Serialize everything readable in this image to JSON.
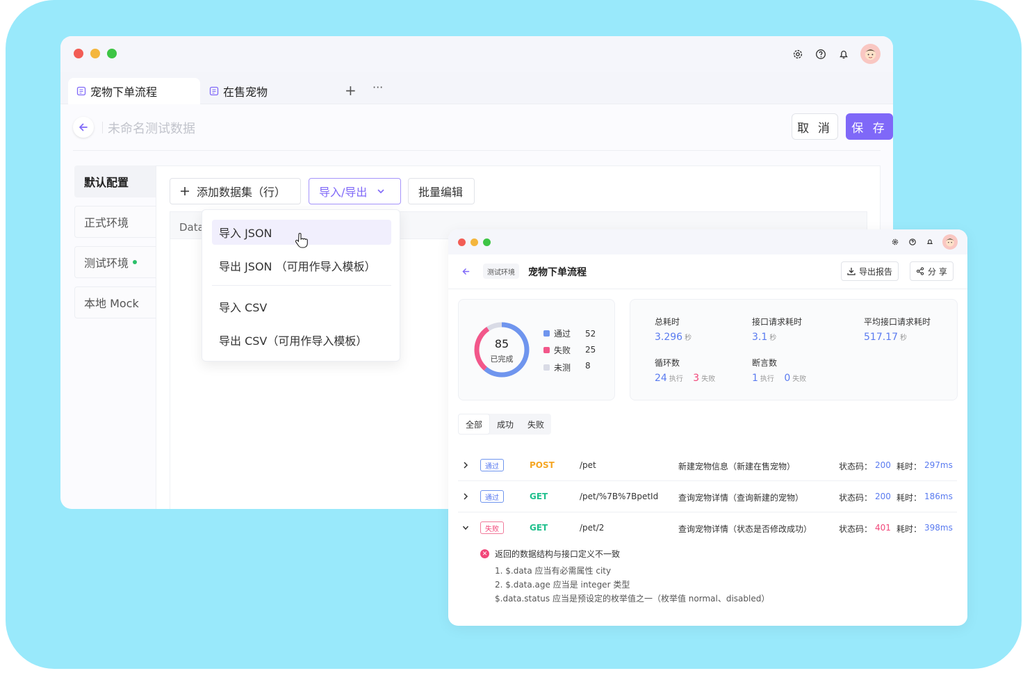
{
  "main": {
    "tabs": [
      {
        "label": "宠物下单流程",
        "active": true
      },
      {
        "label": "在售宠物",
        "active": false
      }
    ],
    "add_tab": "+",
    "more_tabs": "···",
    "title_placeholder": "未命名测试数据",
    "cancel_label": "取 消",
    "save_label": "保 存",
    "env_items": [
      {
        "label": "默认配置",
        "active": true
      },
      {
        "label": "正式环境"
      },
      {
        "label": "测试环境",
        "status": "online"
      },
      {
        "label": "本地 Mock"
      }
    ],
    "toolbar": {
      "add_dataset": "添加数据集（行）",
      "import_export": "导入/导出",
      "batch_edit": "批量编辑"
    },
    "grid_header": "Data",
    "dropdown": [
      {
        "label": "导入 JSON",
        "hover": true
      },
      {
        "label": "导出 JSON （可用作导入模板）"
      },
      {
        "label": "导入 CSV"
      },
      {
        "label": "导出 CSV（可用作导入模板）"
      }
    ]
  },
  "report": {
    "env_tag": "测试环境",
    "title": "宠物下单流程",
    "export_label": "导出报告",
    "share_label": "分 享",
    "summary": {
      "completed": "85",
      "completed_label": "已完成",
      "legend": [
        {
          "label": "通过",
          "value": "52",
          "color": "#6f95ee"
        },
        {
          "label": "失败",
          "value": "25",
          "color": "#f2578a"
        },
        {
          "label": "未测",
          "value": "8",
          "color": "#d9dbe6"
        }
      ]
    },
    "stats": {
      "total_time_label": "总耗时",
      "total_time": "3.296",
      "total_time_unit": "秒",
      "api_time_label": "接口请求耗时",
      "api_time": "3.1",
      "api_time_unit": "秒",
      "avg_time_label": "平均接口请求耗时",
      "avg_time": "517.17",
      "avg_time_unit": "秒",
      "loops_label": "循环数",
      "loops_run": "24",
      "loops_run_unit": "执行",
      "loops_fail": "3",
      "loops_fail_unit": "失败",
      "asserts_label": "断言数",
      "asserts_run": "1",
      "asserts_run_unit": "执行",
      "asserts_fail": "0",
      "asserts_fail_unit": "失败"
    },
    "filters": [
      {
        "label": "全部",
        "active": true
      },
      {
        "label": "成功"
      },
      {
        "label": "失败"
      }
    ],
    "code_label": "状态码：",
    "time_label": "耗时：",
    "rows": [
      {
        "status": "通过",
        "method": "POST",
        "path": "/pet",
        "desc": "新建宠物信息（新建在售宠物）",
        "code": "200",
        "time": "297ms"
      },
      {
        "status": "通过",
        "method": "GET",
        "path": "/pet/%7B%7BpetId",
        "desc": "查询宠物详情（查询新建的宠物）",
        "code": "200",
        "time": "186ms"
      },
      {
        "status": "失败",
        "method": "GET",
        "path": "/pet/2",
        "desc": "查询宠物详情（状态是否修改成功）",
        "code": "401",
        "time": "398ms"
      }
    ],
    "error": {
      "title": "返回的数据结构与接口定义不一致",
      "lines": [
        "1.  $.data 应当有必需属性 city",
        "2. $.data.age 应当是 integer 类型",
        "$.data.status 应当是预设定的枚举值之一（枚举值 normal、disabled）"
      ]
    }
  },
  "colors": {
    "accent": "#7f68f8",
    "background": "#99e9fb",
    "pass": "#5a7bf0",
    "fail": "#f2477a"
  }
}
